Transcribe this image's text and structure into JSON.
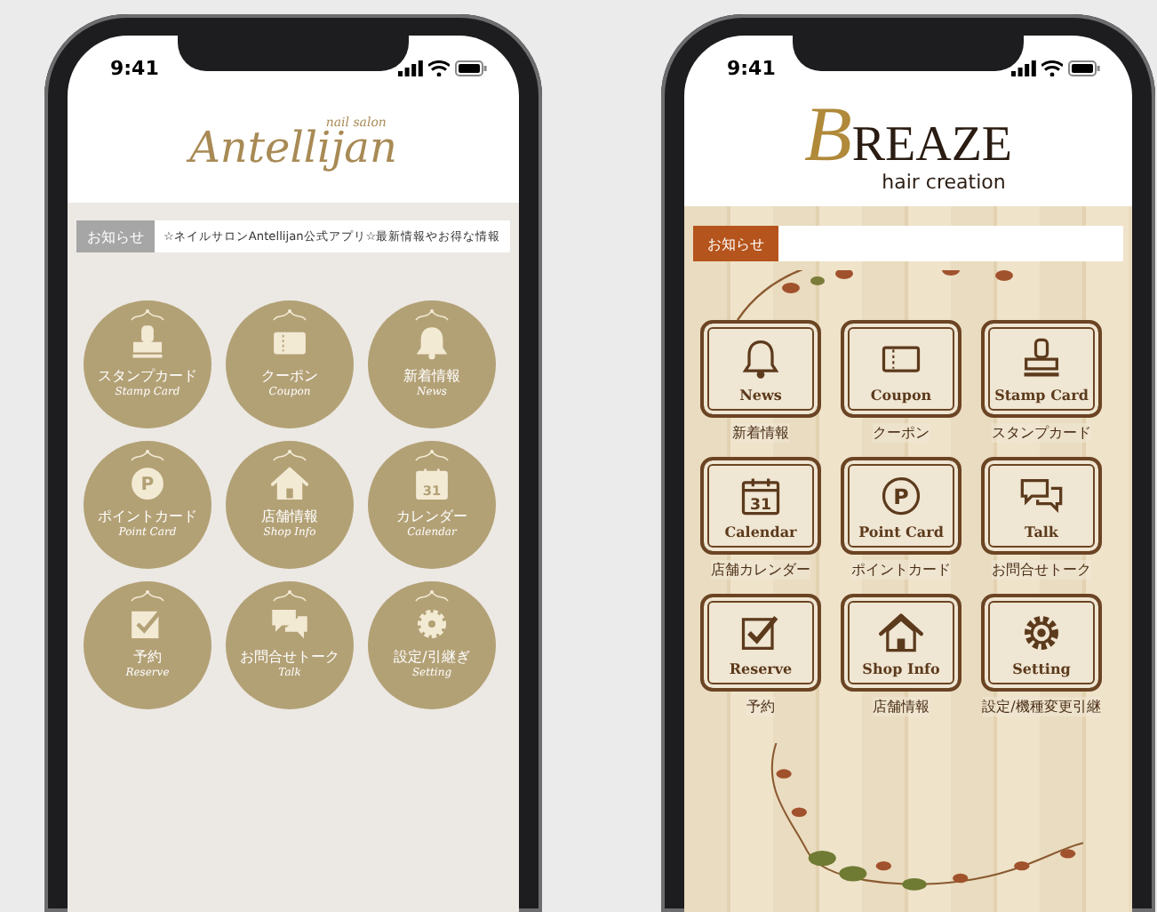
{
  "phones": [
    {
      "kind": "circle",
      "status": {
        "time": "9:41"
      },
      "logo": {
        "name": "Antellijan",
        "tagline": "nail salon"
      },
      "notice": {
        "label": "お知らせ",
        "text": "☆ネイルサロンAntellijan公式アプリ☆最新情報やお得な情報"
      },
      "menu": [
        {
          "label": "スタンプカード",
          "sublabel": "Stamp Card"
        },
        {
          "label": "クーポン",
          "sublabel": "Coupon"
        },
        {
          "label": "新着情報",
          "sublabel": "News"
        },
        {
          "label": "ポイントカード",
          "sublabel": "Point Card",
          "icon_text": "P"
        },
        {
          "label": "店舗情報",
          "sublabel": "Shop Info"
        },
        {
          "label": "カレンダー",
          "sublabel": "Calendar",
          "icon_text": "31"
        },
        {
          "label": "予約",
          "sublabel": "Reserve"
        },
        {
          "label": "お問合せトーク",
          "sublabel": "Talk"
        },
        {
          "label": "設定/引継ぎ",
          "sublabel": "Setting"
        }
      ]
    },
    {
      "kind": "frame",
      "status": {
        "time": "9:41"
      },
      "logo": {
        "initial": "B",
        "name": "REAZE",
        "tagline": "hair creation"
      },
      "notice": {
        "label": "お知らせ"
      },
      "menu": [
        {
          "label": "新着情報",
          "sublabel": "News"
        },
        {
          "label": "クーポン",
          "sublabel": "Coupon"
        },
        {
          "label": "スタンプカード",
          "sublabel": "Stamp Card"
        },
        {
          "label": "店舗カレンダー",
          "sublabel": "Calendar",
          "icon_text": "31"
        },
        {
          "label": "ポイントカード",
          "sublabel": "Point Card",
          "icon_text": "P"
        },
        {
          "label": "お問合せトーク",
          "sublabel": "Talk"
        },
        {
          "label": "予約",
          "sublabel": "Reserve"
        },
        {
          "label": "店舗情報",
          "sublabel": "Shop Info"
        },
        {
          "label": "設定/機種変更引継",
          "sublabel": "Setting"
        }
      ]
    }
  ]
}
